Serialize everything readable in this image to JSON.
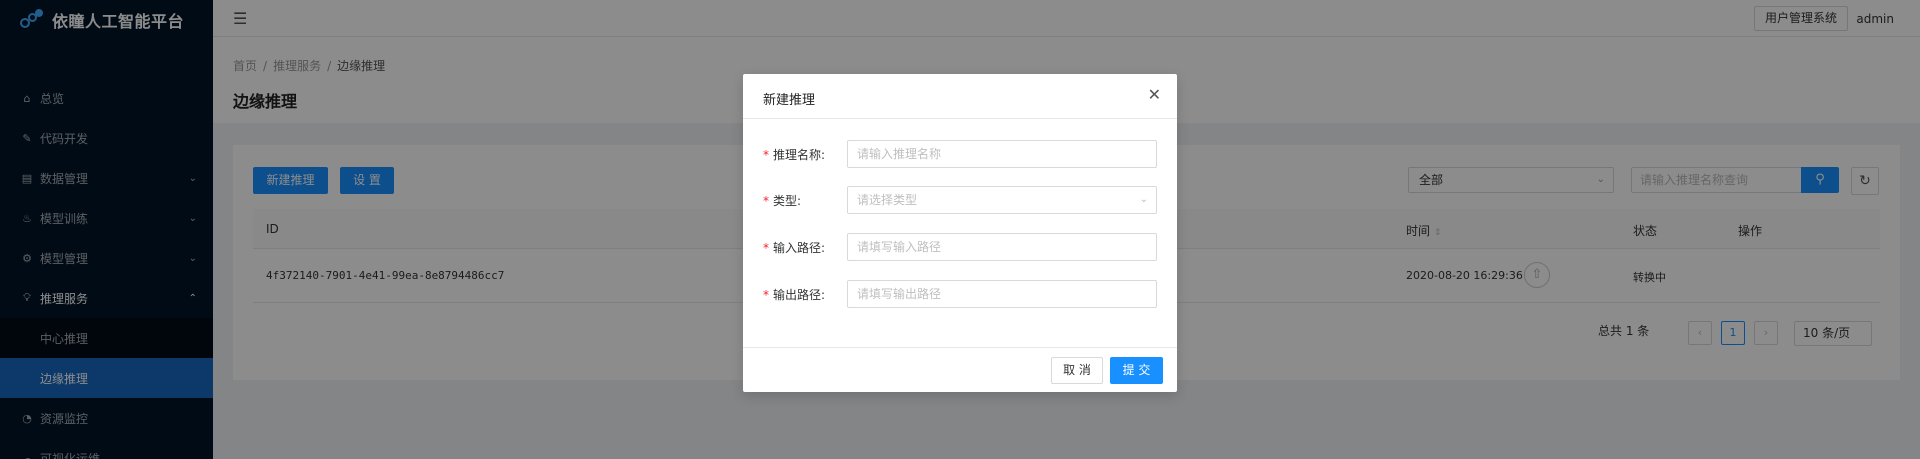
{
  "app": {
    "title": "依瞳人工智能平台"
  },
  "sidebar": {
    "items": [
      {
        "label": "总览",
        "icon": "home-icon"
      },
      {
        "label": "代码开发",
        "icon": "edit-icon"
      },
      {
        "label": "数据管理",
        "icon": "database-icon",
        "has_arrow": true
      },
      {
        "label": "模型训练",
        "icon": "fire-icon",
        "has_arrow": true
      },
      {
        "label": "模型管理",
        "icon": "settings-icon",
        "has_arrow": true
      },
      {
        "label": "推理服务",
        "icon": "bulb-icon",
        "has_arrow": true,
        "expanded": true
      },
      {
        "label": "资源监控",
        "icon": "dashboard-icon"
      },
      {
        "label": "可视化运维",
        "icon": "cloud-icon"
      }
    ],
    "submenu": [
      {
        "label": "中心推理"
      },
      {
        "label": "边缘推理",
        "active": true
      }
    ]
  },
  "header": {
    "user_mgmt_label": "用户管理系统",
    "username": "admin"
  },
  "breadcrumb": [
    "首页",
    "推理服务",
    "边缘推理"
  ],
  "page_title": "边缘推理",
  "toolbar": {
    "create_label": "新建推理",
    "settings_label": "设 置",
    "filter_value": "全部",
    "search_placeholder": "请输入推理名称查询"
  },
  "table": {
    "columns": [
      "ID",
      "时间",
      "状态",
      "操作"
    ],
    "rows": [
      {
        "id": "4f372140-7901-4e41-99ea-8e8794486cc7",
        "time": "2020-08-20 16:29:36",
        "status": "转换中"
      }
    ]
  },
  "pagination": {
    "total_label": "总共 1 条",
    "current_page": "1",
    "page_size": "10 条/页"
  },
  "modal": {
    "title": "新建推理",
    "fields": [
      {
        "label": "推理名称:",
        "placeholder": "请输入推理名称",
        "required": true
      },
      {
        "label": "类型:",
        "placeholder": "请选择类型",
        "required": true,
        "type": "select"
      },
      {
        "label": "输入路径:",
        "placeholder": "请填写输入路径",
        "required": true
      },
      {
        "label": "输出路径:",
        "placeholder": "请填写输出路径",
        "required": true
      }
    ],
    "cancel_label": "取 消",
    "submit_label": "提 交"
  },
  "colors": {
    "primary": "#1890ff",
    "sidebar_bg": "#001529",
    "active_menu": "#1668c0",
    "required": "#f5222d"
  }
}
